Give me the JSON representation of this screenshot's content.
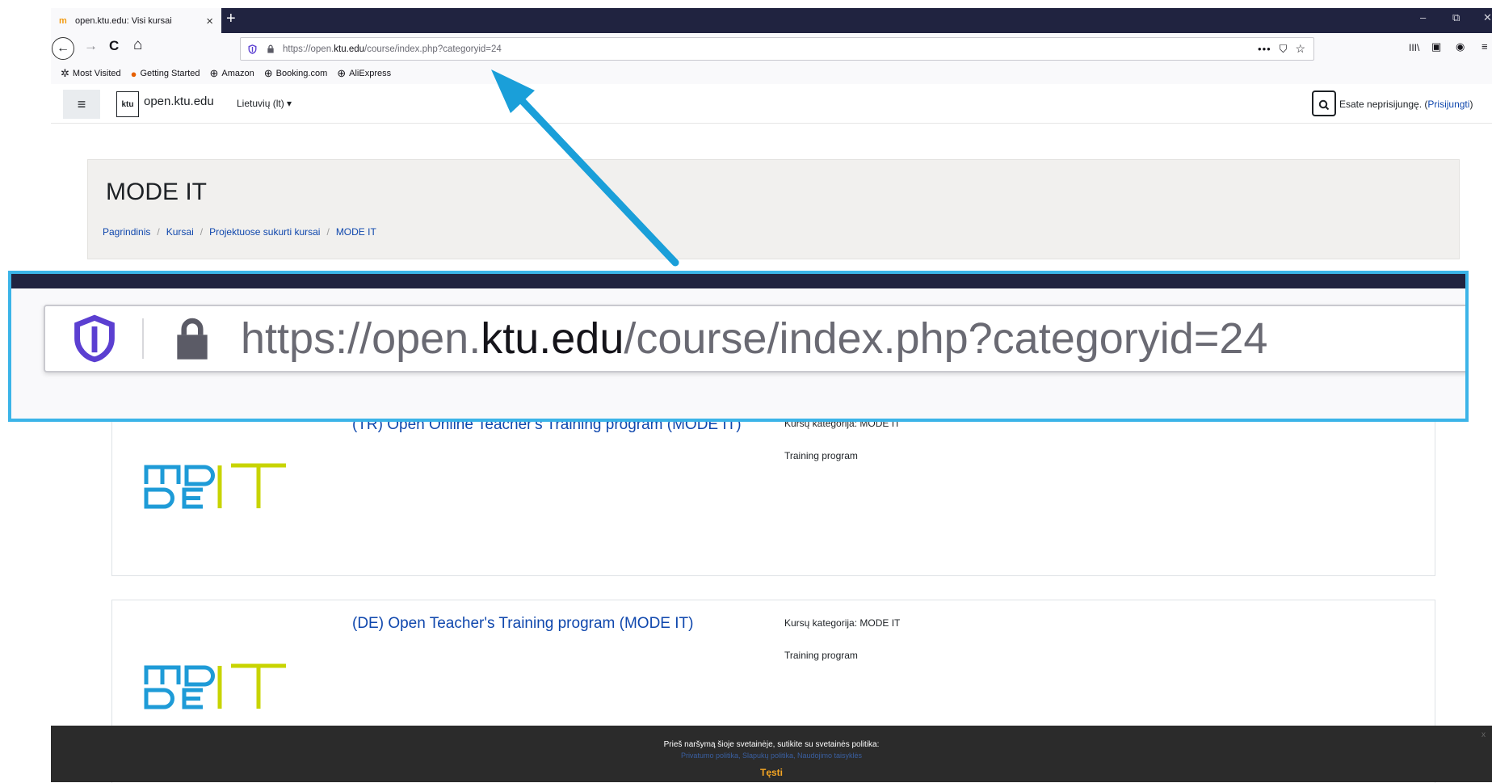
{
  "browser": {
    "tab_title": "open.ktu.edu: Visi kursai",
    "tab_close": "×",
    "new_tab": "+",
    "window_controls": [
      "–",
      "⧉",
      "✕"
    ],
    "back": "←",
    "forward": "→",
    "reload": "C",
    "home": "⌂",
    "url_prefix": "https://open.",
    "url_domain": "ktu.edu",
    "url_path": "/course/index.php?categoryid=24",
    "page_actions": "•••",
    "toolbar_icons": [
      "III\\",
      "▣",
      "◉",
      "≡"
    ],
    "bookmarks": [
      {
        "icon": "✲",
        "label": "Most Visited"
      },
      {
        "icon": "●",
        "label": "Getting Started"
      },
      {
        "icon": "⊕",
        "label": "Amazon"
      },
      {
        "icon": "⊕",
        "label": "Booking.com"
      },
      {
        "icon": "⊕",
        "label": "AliExpress"
      }
    ]
  },
  "site": {
    "menu": "≡",
    "logo_text": "ktu",
    "name": "open.ktu.edu",
    "language": "Lietuvių (lt) ▾",
    "search": "🔍",
    "login_text": "Esate neprisijungę. (",
    "login_link": "Prisijungti",
    "login_close": ")"
  },
  "page": {
    "title": "MODE IT",
    "breadcrumb": [
      "Pagrindinis",
      "Kursai",
      "Projektuose sukurti kursai",
      "MODE IT"
    ]
  },
  "courses": [
    {
      "title": "(TR) Open Online Teacher's Training program (MODE IT)",
      "category": "Kursų kategorija: MODE IT",
      "summary": "Training program"
    },
    {
      "title": "(DE) Open Teacher's Training program (MODE IT)",
      "category": "Kursų kategorija: MODE IT",
      "summary": "Training program"
    }
  ],
  "zoom": {
    "url_prefix": "https://open.",
    "url_domain": "ktu.edu",
    "url_path": "/course/index.php?categoryid=24"
  },
  "cookie": {
    "message": "Prieš naršymą šioje svetainėje, sutikite su svetainės politika:",
    "links": "Privatumo politika, Slapukų politika, Naudojimo taisyklės",
    "accept": "Tęsti",
    "close": "x"
  },
  "colors": {
    "accent": "#3bb4e8",
    "link": "#0f47ad",
    "logo_blue": "#1e9bd7",
    "logo_green": "#c8d400"
  }
}
